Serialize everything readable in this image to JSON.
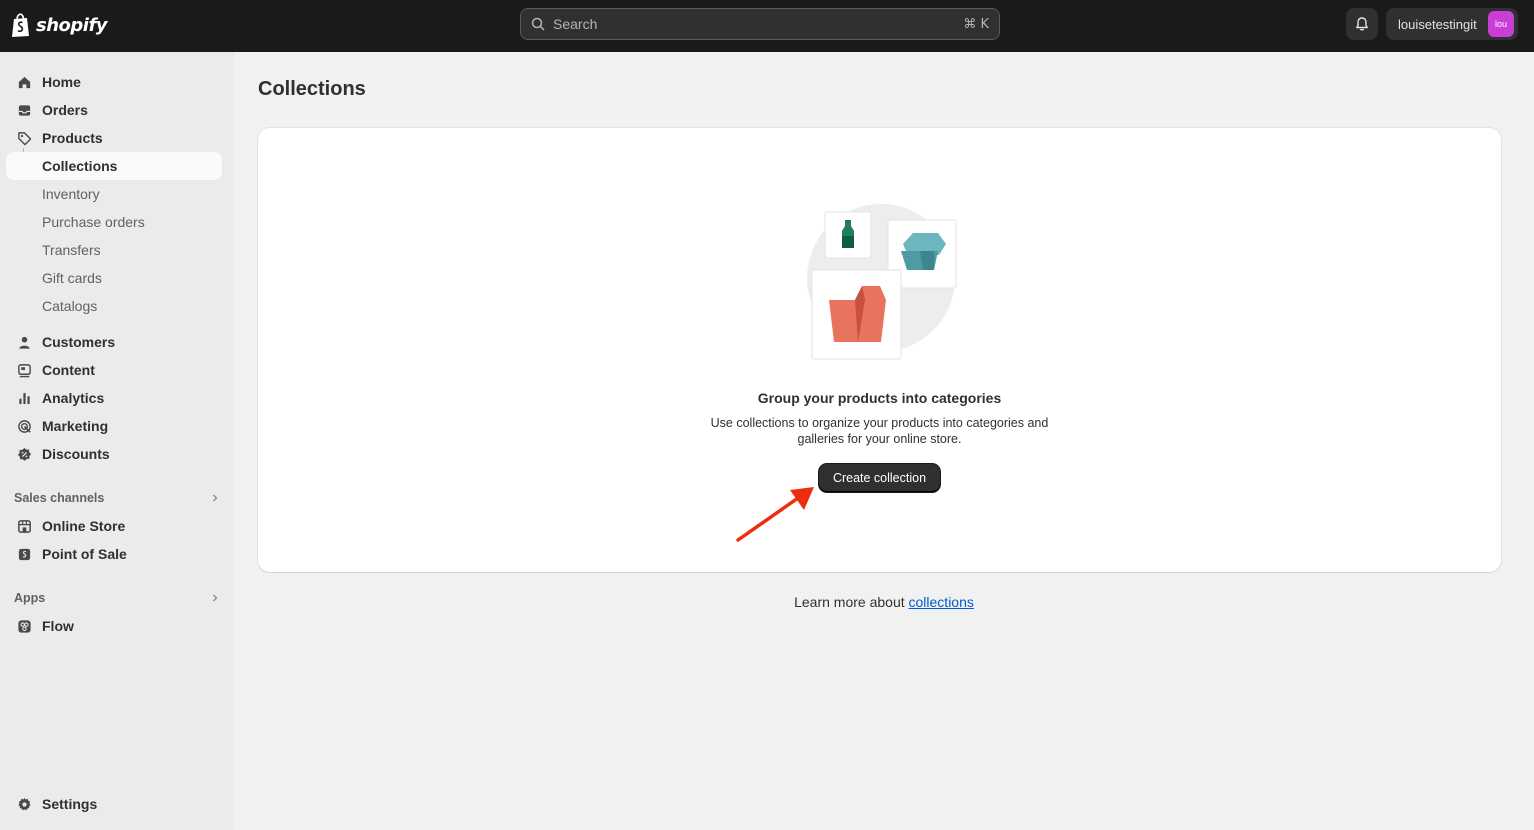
{
  "topbar": {
    "logo_text": "shopify",
    "search": {
      "placeholder": "Search",
      "shortcut": "⌘ K"
    },
    "user": {
      "name": "louisetestingit",
      "avatar_initials": "lou",
      "avatar_color": "#c93fd6"
    }
  },
  "sidebar": {
    "items": [
      {
        "label": "Home",
        "icon": "home-icon"
      },
      {
        "label": "Orders",
        "icon": "inbox-icon"
      },
      {
        "label": "Products",
        "icon": "tag-icon"
      },
      {
        "label": "Collections",
        "active": true
      },
      {
        "label": "Inventory"
      },
      {
        "label": "Purchase orders"
      },
      {
        "label": "Transfers"
      },
      {
        "label": "Gift cards"
      },
      {
        "label": "Catalogs"
      },
      {
        "label": "Customers",
        "icon": "person-icon"
      },
      {
        "label": "Content",
        "icon": "content-icon"
      },
      {
        "label": "Analytics",
        "icon": "bar-chart-icon"
      },
      {
        "label": "Marketing",
        "icon": "target-icon"
      },
      {
        "label": "Discounts",
        "icon": "discount-icon"
      }
    ],
    "sales_channels": {
      "title": "Sales channels",
      "items": [
        {
          "label": "Online Store",
          "icon": "store-icon"
        },
        {
          "label": "Point of Sale",
          "icon": "pos-icon"
        }
      ]
    },
    "apps": {
      "title": "Apps",
      "items": [
        {
          "label": "Flow",
          "icon": "flow-icon"
        }
      ]
    },
    "settings_label": "Settings"
  },
  "main": {
    "title": "Collections",
    "empty_state": {
      "heading": "Group your products into categories",
      "body": "Use collections to organize your products into categories and galleries for your online store.",
      "button": "Create collection"
    },
    "learn_more": {
      "prefix": "Learn more about ",
      "link": "collections"
    }
  },
  "colors": {
    "topbar": "#1a1a1a",
    "sidebar": "#ebebeb",
    "page": "#f1f1f1",
    "link": "#005bd3",
    "annotation_arrow": "#ee2d0f"
  }
}
